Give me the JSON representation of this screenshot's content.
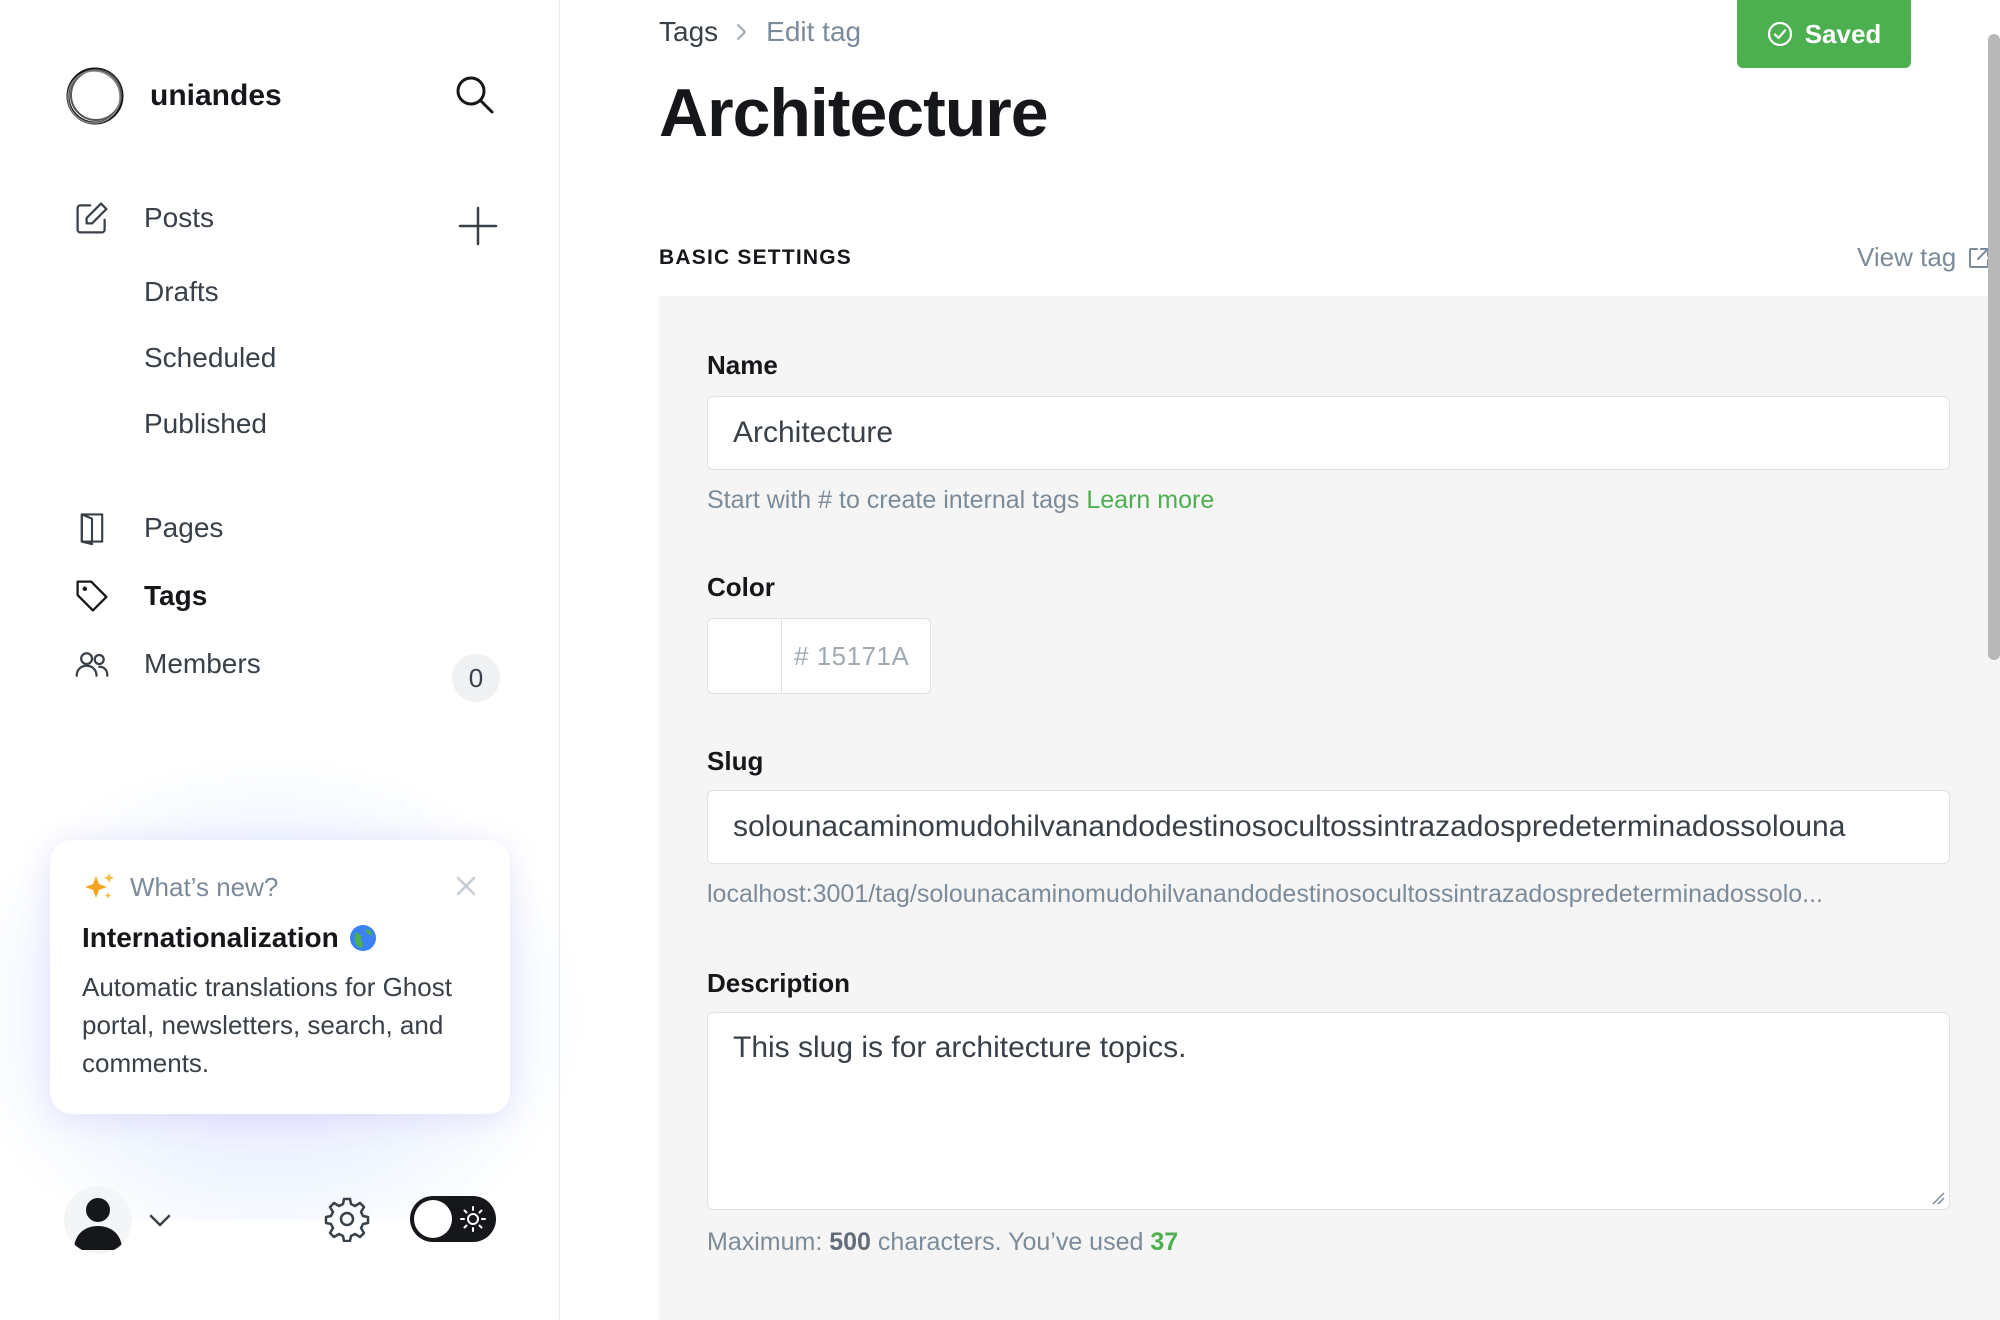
{
  "sidebar": {
    "brand_name": "uniandes",
    "nav": {
      "posts": "Posts",
      "drafts": "Drafts",
      "scheduled": "Scheduled",
      "published": "Published",
      "pages": "Pages",
      "tags": "Tags",
      "members": "Members",
      "members_count": "0"
    },
    "whats_new": {
      "heading": "What’s new?",
      "title": "Internationalization",
      "body": "Automatic translations for Ghost portal, newsletters, search, and comments."
    }
  },
  "main": {
    "breadcrumb": {
      "root": "Tags",
      "current": "Edit tag"
    },
    "title": "Architecture",
    "saved_label": "Saved",
    "section_heading": "BASIC SETTINGS",
    "view_tag_label": "View tag",
    "form": {
      "name_label": "Name",
      "name_value": "Architecture",
      "name_hint": "Start with # to create internal tags",
      "name_hint_link": "Learn more",
      "color_label": "Color",
      "color_hash": "#",
      "color_placeholder": "15171A",
      "slug_label": "Slug",
      "slug_value": "solounacaminomudohilvanandodestinosocultossintrazadospredeterminadossolouna",
      "slug_url": "localhost:3001/tag/solounacaminomudohilvanandodestinosocultossintrazadospredeterminadossolo...",
      "description_label": "Description",
      "description_value": "This slug is for architecture topics.",
      "description_hint_prefix": "Maximum:",
      "description_max": "500",
      "description_hint_middle": "characters. You’ve used",
      "description_used": "37"
    }
  },
  "colors": {
    "accent_green": "#4caf50",
    "text_dark": "#15171a",
    "text_muted": "#7c8b9a",
    "panel_bg": "#f4f5f4"
  }
}
